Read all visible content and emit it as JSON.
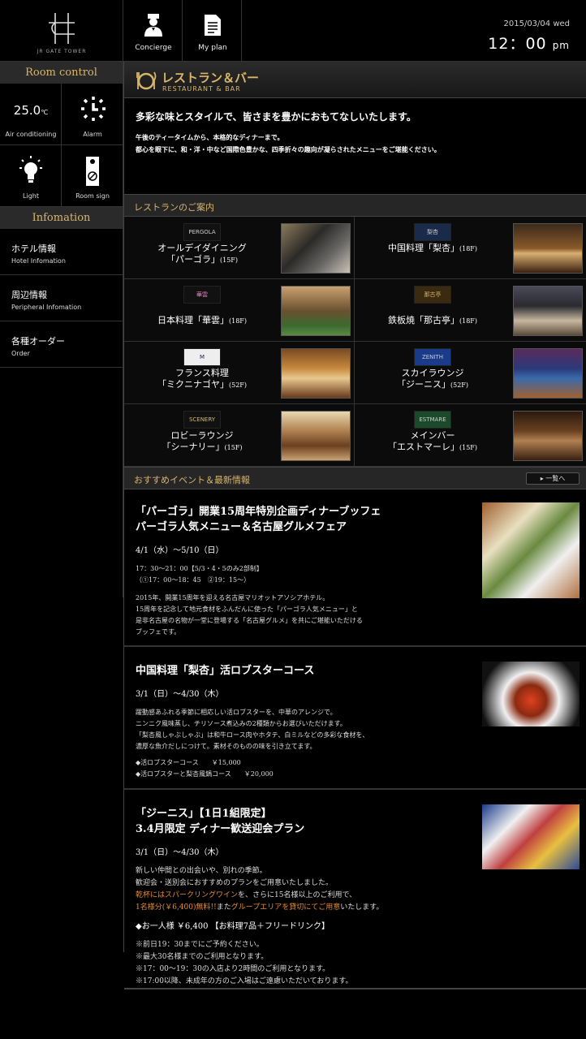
{
  "header": {
    "logo_text": "JR GATE TOWER",
    "buttons": [
      {
        "label": "Concierge",
        "icon": "concierge-icon"
      },
      {
        "label": "My plan",
        "icon": "document-icon"
      }
    ],
    "date": "2015/03/04 wed",
    "time": "12：00",
    "ampm": "pm"
  },
  "sidebar": {
    "room_control_title": "Room control",
    "controls": [
      {
        "label": "Air conditioning",
        "value": "25.0",
        "unit": "℃"
      },
      {
        "label": "Alarm",
        "icon": "clock-icon"
      },
      {
        "label": "Light",
        "icon": "light-bulb-icon"
      },
      {
        "label": "Room sign",
        "icon": "door-sign-icon"
      }
    ],
    "info_title": "Infomation",
    "info_items": [
      {
        "ja": "ホテル情報",
        "en": "Hotel Infomation"
      },
      {
        "ja": "周辺情報",
        "en": "Peripheral Infomation"
      },
      {
        "ja": "各種オーダー",
        "en": "Order"
      }
    ]
  },
  "page": {
    "title_ja": "レストラン＆バー",
    "title_en": "RESTAURANT & BAR",
    "lead": "多彩な味とスタイルで、皆さまを豊かにおもてなしいたします。",
    "sub1": "午後のティータイムから、本格的なディナーまで。",
    "sub2": "都心を眼下に、和・洋・中など国際色豊かな、四季折々の趣向が凝らされたメニューをご堪能ください。",
    "restaurant_section": "レストランのご案内",
    "events_section": "おすすめイベント＆最新情報",
    "more_button": "一覧へ"
  },
  "restaurants": [
    {
      "logo": "PERGOLA",
      "line1": "オールデイダイニング",
      "line2": "「パーゴラ」",
      "floor": "(15F)"
    },
    {
      "logo": "梨杏",
      "line1": "中国料理「梨杏」",
      "line2": "",
      "floor": "(18F)"
    },
    {
      "logo": "華雲",
      "line1": "日本料理「華雲」",
      "line2": "",
      "floor": "(18F)"
    },
    {
      "logo": "那古亭",
      "line1": "鉄板焼「那古亭」",
      "line2": "",
      "floor": "(18F)"
    },
    {
      "logo": "M",
      "line1": "フランス料理",
      "line2": "「ミクニナゴヤ」",
      "floor": "(52F)"
    },
    {
      "logo": "ZENITH",
      "line1": "スカイラウンジ",
      "line2": "「ジーニス」",
      "floor": "(52F)"
    },
    {
      "logo": "SCENERY",
      "line1": "ロビーラウンジ",
      "line2": "「シーナリー」",
      "floor": "(15F)"
    },
    {
      "logo": "ESTMARE",
      "line1": "メインバー",
      "line2": "「エストマーレ」",
      "floor": "(15F)"
    }
  ],
  "events": [
    {
      "title1": "「パーゴラ」開業15周年特別企画ディナーブッフェ",
      "title2": "パーゴラ人気メニュー＆名古屋グルメフェア",
      "date": "4/1（水）～5/10（日）",
      "lines": [
        "17：30～21：00【5/3・4・5のみ2部制】",
        "（①17：00～18：45　②19：15～）",
        "",
        "2015年、開業15周年を迎える名古屋マリオットアソシアホテル。",
        "15周年を記念して地元食材をふんだんに使った「パーゴラ人気メニュー」と",
        "是非名古屋の名物が一堂に登場する「名古屋グルメ」を共にご堪能いただける",
        "ブッフェです。"
      ]
    },
    {
      "title1": "中国料理「梨杏」活ロブスターコース",
      "title2": "",
      "date": "3/1（日）～4/30（木）",
      "lines": [
        "躍動感あふれる季節に相応しい活ロブスターを、中華のアレンジで。",
        "ニンニク風味蒸し、チリソース煮込みの2種類からお選びいただけます。",
        "「梨杏風しゃぶしゃぶ」は和牛ロース肉やホタテ、白ミルなどの多彩な食材を、",
        "濃厚な魚介だしにつけて。素材そのものの味を引き立てます。",
        "",
        "◆活ロブスターコース　　￥15,000",
        "◆活ロブスターと梨杏風鍋コース　　￥20,000"
      ]
    },
    {
      "title1": "「ジーニス」【1日1組限定】",
      "title2": "3.4月限定 ディナー歓送迎会プラン",
      "date": "3/1（日）～4/30（木）",
      "line_a": "新しい仲間との出会いや、別れの季節。",
      "line_b": "歓迎会・送別会におすすめのプランをご用意いたしました。",
      "line_c1": "乾杯にはスパークリングワイン",
      "line_c2": "を、さらに15名様以上のご利用で、",
      "line_d1": "1名様分(￥6,400)無料!!",
      "line_d2": "また",
      "line_d3": "グループエリアを貸切にてご用意",
      "line_d4": "いたします。",
      "price": "◆お一人様 ￥6,400 【お料理7品＋フリードリンク】",
      "notes": [
        "※前日19：30までにご予約ください。",
        "※最大30名様までのご利用となります。",
        "※17：00～19：30の入店より2時間のご利用となります。",
        "※17:00以降、未成年の方のご入場はご遠慮いただいております。"
      ]
    }
  ]
}
